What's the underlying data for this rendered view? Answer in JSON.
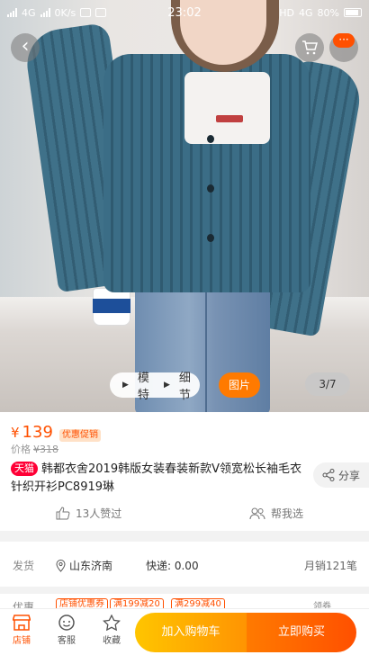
{
  "status_bar": {
    "network": "4G",
    "speed": "0K/s",
    "time": "23:02",
    "hd": "HD",
    "network_right": "4G",
    "battery": "80%"
  },
  "hero": {
    "media_tabs": [
      "模特",
      "细节"
    ],
    "pictures_label": "图片",
    "counter": "3/7",
    "cart_badge": "···"
  },
  "product": {
    "currency": "¥",
    "price": "139",
    "coupon_label": "优惠促销",
    "orig_price_label": "价格",
    "orig_price": "¥318",
    "store_tag": "天猫",
    "title": "韩都衣舍2019韩版女装春装新款V领宽松长袖毛衣针织开衫PC8919琳",
    "share_label": "分享",
    "likes": "13人赞过",
    "help_label": "帮我选"
  },
  "shipping": {
    "label": "发货",
    "location": "山东济南",
    "fee": "快递: 0.00",
    "sales": "月销121笔"
  },
  "promo": {
    "label": "优惠",
    "tags": [
      "店铺优惠券",
      "满199减20",
      "满299减40"
    ],
    "more": "领券"
  },
  "bottom_bar": {
    "shop": "店铺",
    "service": "客服",
    "favorite": "收藏",
    "add_to_cart": "加入购物车",
    "buy_now": "立即购买"
  },
  "colors": {
    "accent": "#ff5000",
    "tmall": "#ff0036",
    "cart_gradient_start": "#ffc500",
    "buy_gradient_end": "#ff5000"
  }
}
